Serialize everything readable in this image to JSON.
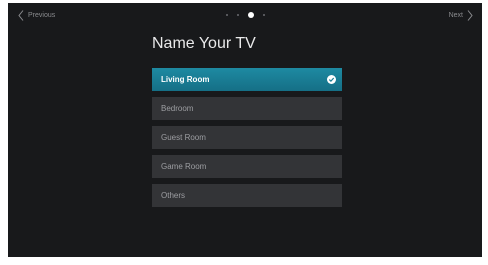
{
  "nav": {
    "previous_label": "Previous",
    "next_label": "Next"
  },
  "pager": {
    "total_steps": 4,
    "current_step": 3
  },
  "title": "Name Your TV",
  "options": [
    {
      "label": "Living Room",
      "selected": true
    },
    {
      "label": "Bedroom",
      "selected": false
    },
    {
      "label": "Guest Room",
      "selected": false
    },
    {
      "label": "Game Room",
      "selected": false
    },
    {
      "label": "Others",
      "selected": false
    }
  ],
  "colors": {
    "background": "#18191b",
    "option_background": "#333437",
    "selected_accent": "#1a7f96",
    "title_text": "#e9e9ea"
  },
  "icons": {
    "previous": "chevron-left-icon",
    "next": "chevron-right-icon",
    "selected": "check-circle-icon"
  }
}
